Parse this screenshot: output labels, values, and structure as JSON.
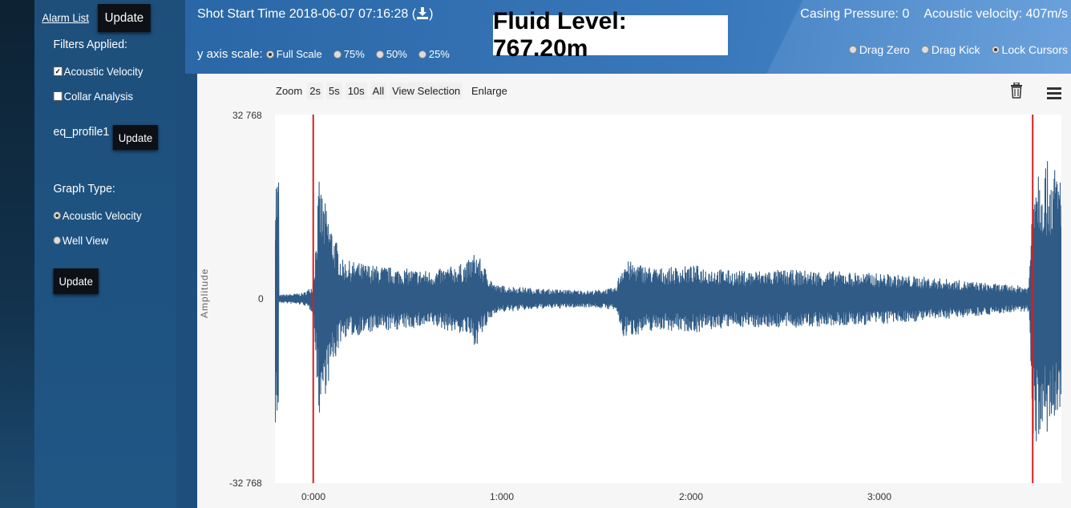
{
  "sidebar": {
    "alarm_list": "Alarm List",
    "update_top": "Update",
    "filters_title": "Filters Applied:",
    "filters": [
      {
        "label": "Acoustic Velocity",
        "checked": true
      },
      {
        "label": "Collar Analysis",
        "checked": false
      }
    ],
    "profile": "eq_profile1",
    "update_profile": "Update",
    "graph_type_title": "Graph Type:",
    "graph_types": [
      {
        "label": "Acoustic Velocity",
        "selected": true
      },
      {
        "label": "Well View",
        "selected": false
      }
    ],
    "update_bottom": "Update"
  },
  "header": {
    "shot_start": "Shot Start Time 2018-06-07 07:16:28 (",
    "shot_end": ")",
    "y_axis_scale_label": "y axis scale:",
    "y_axis_options": [
      {
        "label": "Full Scale",
        "selected": true
      },
      {
        "label": "75%",
        "selected": false
      },
      {
        "label": "50%",
        "selected": false
      },
      {
        "label": "25%",
        "selected": false
      }
    ],
    "fluid_level": "Fluid Level: 767.20m",
    "casing_pressure_label": "Casing Pressure:",
    "casing_pressure_value": "0",
    "acoustic_velocity_label": "Acoustic velocity:",
    "acoustic_velocity_value": "407m/s",
    "drag_options": [
      {
        "label": "Drag Zero",
        "selected": false
      },
      {
        "label": "Drag Kick",
        "selected": false
      },
      {
        "label": "Lock Cursors",
        "selected": true
      }
    ]
  },
  "toolbar": {
    "zoom_label": "Zoom",
    "zoom_buttons": [
      "2s",
      "5s",
      "10s",
      "All",
      "View Selection"
    ],
    "enlarge": "Enlarge"
  },
  "chart_data": {
    "type": "line",
    "ylabel": "Amplitude",
    "ylim": [
      -32768,
      32768
    ],
    "y_ticks": [
      "32 768",
      "0",
      "-32 768"
    ],
    "x_ticks": [
      "0:000",
      "1:000",
      "2:000",
      "3:000"
    ],
    "xlim_seconds": [
      -0.2,
      3.91
    ],
    "cursors_seconds": [
      0.0,
      3.76
    ],
    "series_color": "#2f5b86",
    "cursor_color": "#d42020",
    "envelope": [
      {
        "t": -0.18,
        "a": 700
      },
      {
        "t": -0.05,
        "a": 1100
      },
      {
        "t": 0.0,
        "a": 2500
      },
      {
        "t": 0.03,
        "a": 21000
      },
      {
        "t": 0.08,
        "a": 15000
      },
      {
        "t": 0.15,
        "a": 7000
      },
      {
        "t": 0.32,
        "a": 6000
      },
      {
        "t": 0.45,
        "a": 5500
      },
      {
        "t": 0.62,
        "a": 5000
      },
      {
        "t": 0.8,
        "a": 6500
      },
      {
        "t": 0.85,
        "a": 8500
      },
      {
        "t": 0.95,
        "a": 2500
      },
      {
        "t": 1.2,
        "a": 1800
      },
      {
        "t": 1.45,
        "a": 1500
      },
      {
        "t": 1.58,
        "a": 2000
      },
      {
        "t": 1.62,
        "a": 7000
      },
      {
        "t": 1.8,
        "a": 5500
      },
      {
        "t": 2.0,
        "a": 6000
      },
      {
        "t": 2.2,
        "a": 5000
      },
      {
        "t": 2.45,
        "a": 5200
      },
      {
        "t": 2.7,
        "a": 5000
      },
      {
        "t": 3.0,
        "a": 4500
      },
      {
        "t": 3.3,
        "a": 3600
      },
      {
        "t": 3.6,
        "a": 2600
      },
      {
        "t": 3.74,
        "a": 2300
      },
      {
        "t": 3.765,
        "a": 26000
      },
      {
        "t": 3.91,
        "a": 23000
      }
    ]
  }
}
